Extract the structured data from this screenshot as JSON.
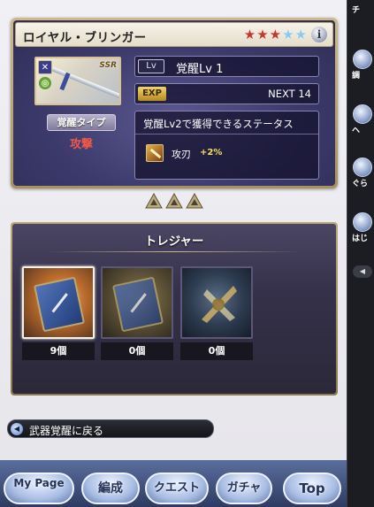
{
  "weapon": {
    "name": "ロイヤル・ブリンガー",
    "stars_filled": 3,
    "stars_total": 5,
    "rarity": "SSR",
    "type_label": "覚醒タイプ",
    "type_value": "攻撃",
    "lv_badge": "Lv",
    "lv_text": "覚醒Lv 1",
    "exp_badge": "EXP",
    "exp_next": "NEXT 14",
    "status_title": "覚醒Lv2で獲得できるステータス",
    "skill_name": "攻刃",
    "skill_value": "+2%"
  },
  "awakening_levels_shown": 3,
  "treasure": {
    "title": "トレジャー",
    "items": [
      {
        "icon": "blue-book-icon",
        "count": "9個",
        "selected": true
      },
      {
        "icon": "blue-book-icon",
        "count": "0個",
        "selected": false
      },
      {
        "icon": "weapon-fragment-icon",
        "count": "0個",
        "selected": false
      }
    ]
  },
  "back_link": "武器覚醒に戻る",
  "bottom_nav": [
    "My Page",
    "編成",
    "クエスト",
    "ガチャ",
    "Top"
  ],
  "sidebar": [
    "チ",
    "調",
    "ヘ",
    "ぐら",
    "はじ"
  ],
  "colors": {
    "accent_red": "#f0584a",
    "star_red": "#c9362a",
    "star_blue": "#8ec8ef",
    "bonus_yellow": "#f4e15a"
  }
}
